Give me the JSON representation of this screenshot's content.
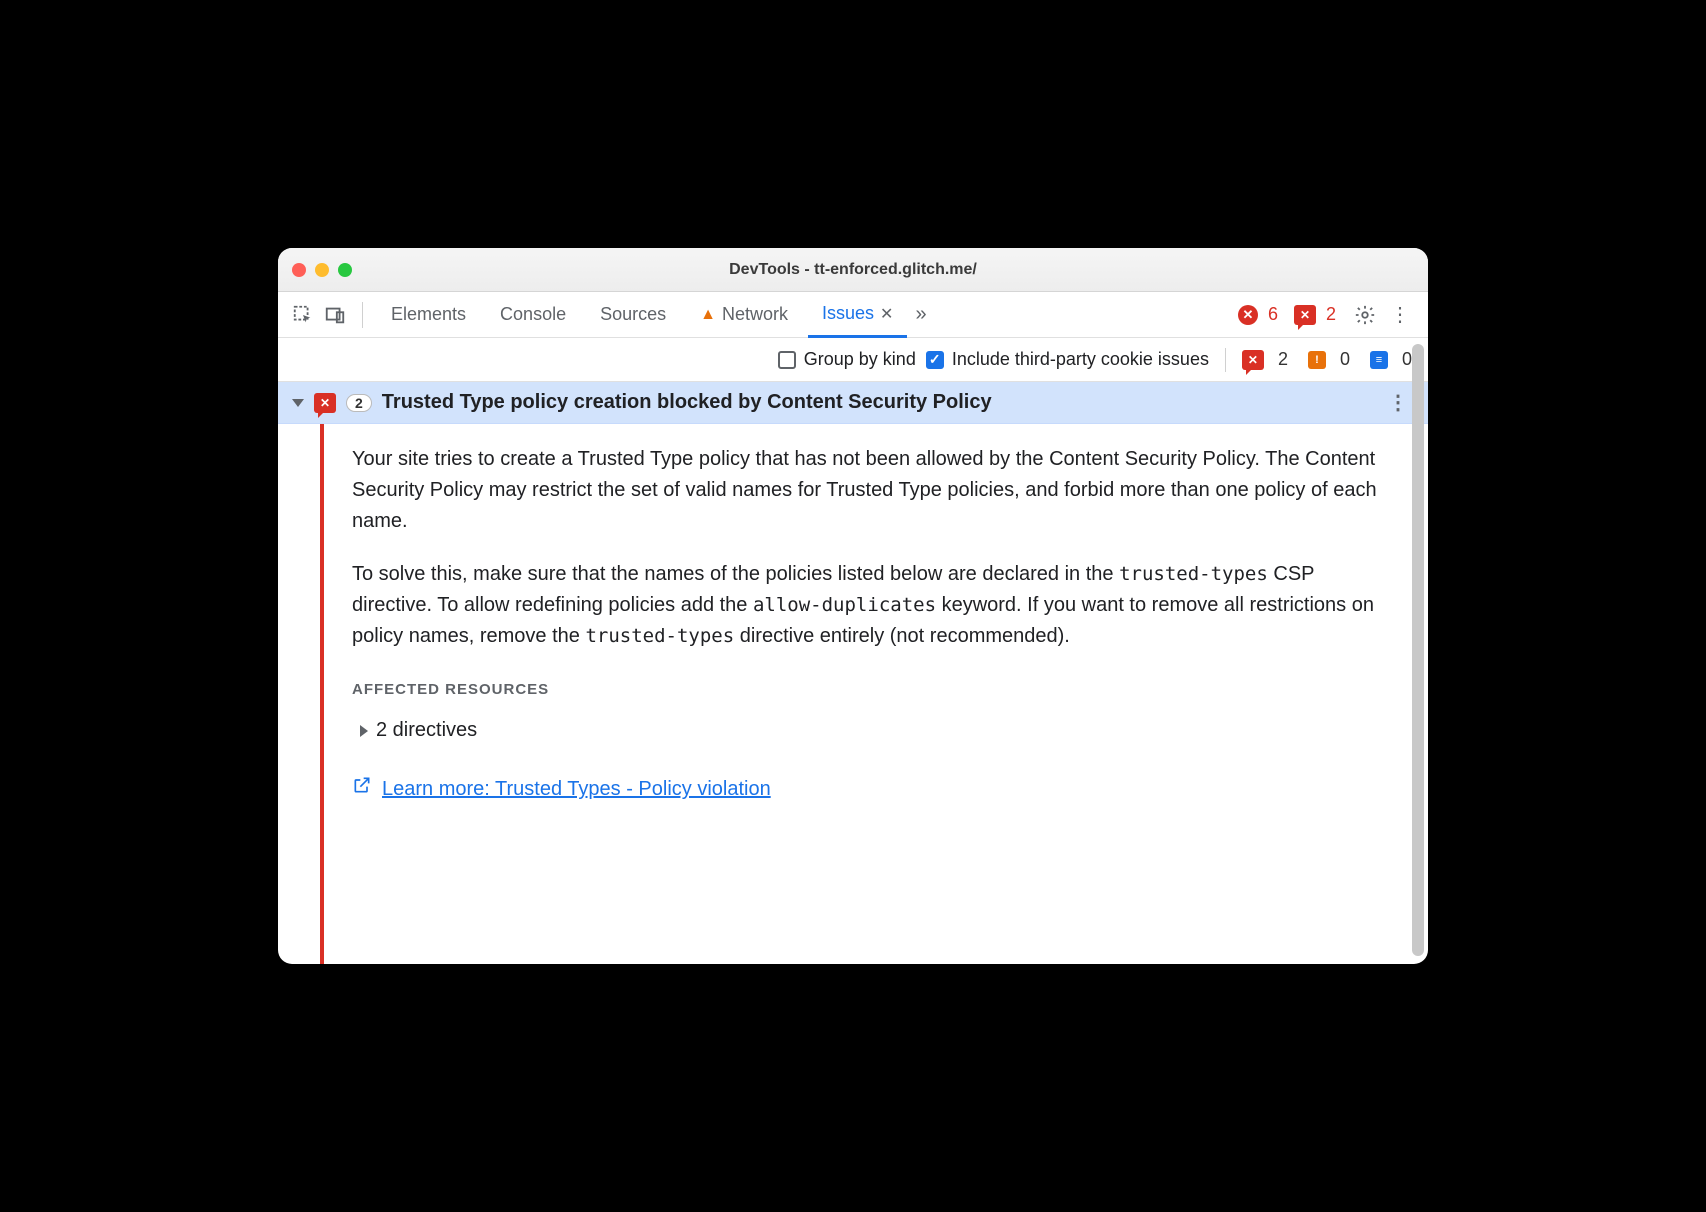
{
  "window": {
    "title": "DevTools - tt-enforced.glitch.me/"
  },
  "tabs": {
    "elements": "Elements",
    "console": "Console",
    "sources": "Sources",
    "network": "Network",
    "issues": "Issues"
  },
  "tabbar_counts": {
    "errors": "6",
    "issues": "2"
  },
  "toolbar": {
    "group_by_kind": "Group by kind",
    "third_party": "Include third-party cookie issues",
    "counts": {
      "red": "2",
      "orange": "0",
      "blue": "0"
    }
  },
  "issue": {
    "count": "2",
    "title": "Trusted Type policy creation blocked by Content Security Policy",
    "p1": "Your site tries to create a Trusted Type policy that has not been allowed by the Content Security Policy. The Content Security Policy may restrict the set of valid names for Trusted Type policies, and forbid more than one policy of each name.",
    "p2a": "To solve this, make sure that the names of the policies listed below are declared in the ",
    "p2code1": "trusted-types",
    "p2b": " CSP directive. To allow redefining policies add the ",
    "p2code2": "allow-duplicates",
    "p2c": " keyword. If you want to remove all restrictions on policy names, remove the ",
    "p2code3": "trusted-types",
    "p2d": " directive entirely (not recommended).",
    "affected_label": "AFFECTED RESOURCES",
    "directives": "2 directives",
    "learn_more": "Learn more: Trusted Types - Policy violation"
  }
}
